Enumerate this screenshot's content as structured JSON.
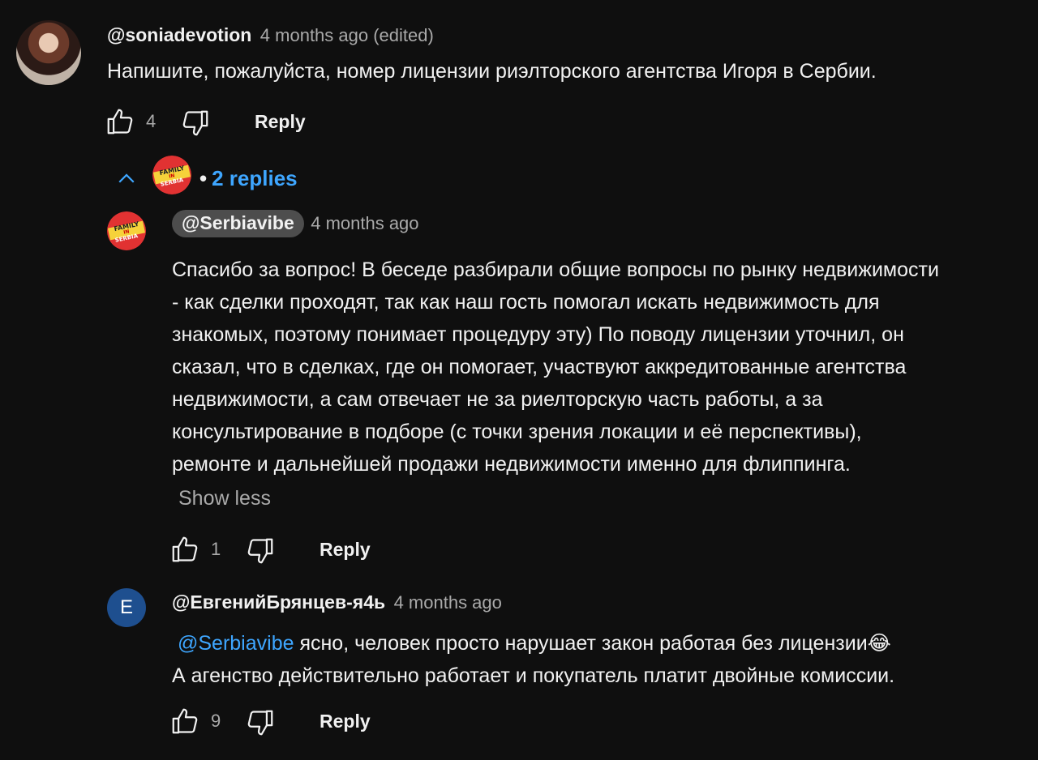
{
  "comment1": {
    "author": "@soniadevotion",
    "time": "4 months ago (edited)",
    "text": "Напишите, пожалуйста, номер лицензии риэлторского агентства Игоря в Сербии.",
    "likes": "4",
    "reply_label": "Reply",
    "replies_label": "2 replies",
    "bullet": "•",
    "channel_logo_lines": [
      "FAMILY",
      "IN",
      "SERBIA"
    ]
  },
  "reply1": {
    "author": "@Serbiavibe",
    "time": "4 months ago",
    "text_lines": [
      "Спасибо за вопрос! В беседе разбирали общие вопросы по рынку недвижимости",
      "- как сделки проходят, так как наш гость помогал искать недвижимость для",
      "знакомых, поэтому понимает процедуру эту) По поводу лицензии уточнил, он",
      "сказал, что в сделках, где он помогает, участвуют аккредитованные агентства",
      "недвижимости, а сам отвечает не за риелторскую часть работы, а за",
      "консультирование в подборе (с точки зрения локации и её перспективы),",
      "ремонте и дальнейшей продажи недвижимости именно для флиппинга."
    ],
    "show_less": "Show less",
    "likes": "1",
    "reply_label": "Reply"
  },
  "reply2": {
    "avatar_letter": "E",
    "author": "@ЕвгенийБрянцев-я4ь",
    "time": "4 months ago",
    "mention": "@Serbiavibe",
    "line1": " ясно, человек просто нарушает закон работая без лицензии",
    "emoji": "😂",
    "line2": "А агенство действительно работает и покупатель платит двойные комиссии.",
    "likes": "9",
    "reply_label": "Reply"
  },
  "colors": {
    "background": "#0f0f0f",
    "link": "#3ea6ff",
    "muted": "#aaaaaa",
    "avatar_e": "#1e4f8f"
  },
  "icons": [
    "thumb-up-icon",
    "thumb-down-icon",
    "chevron-up-icon",
    "avatar"
  ]
}
